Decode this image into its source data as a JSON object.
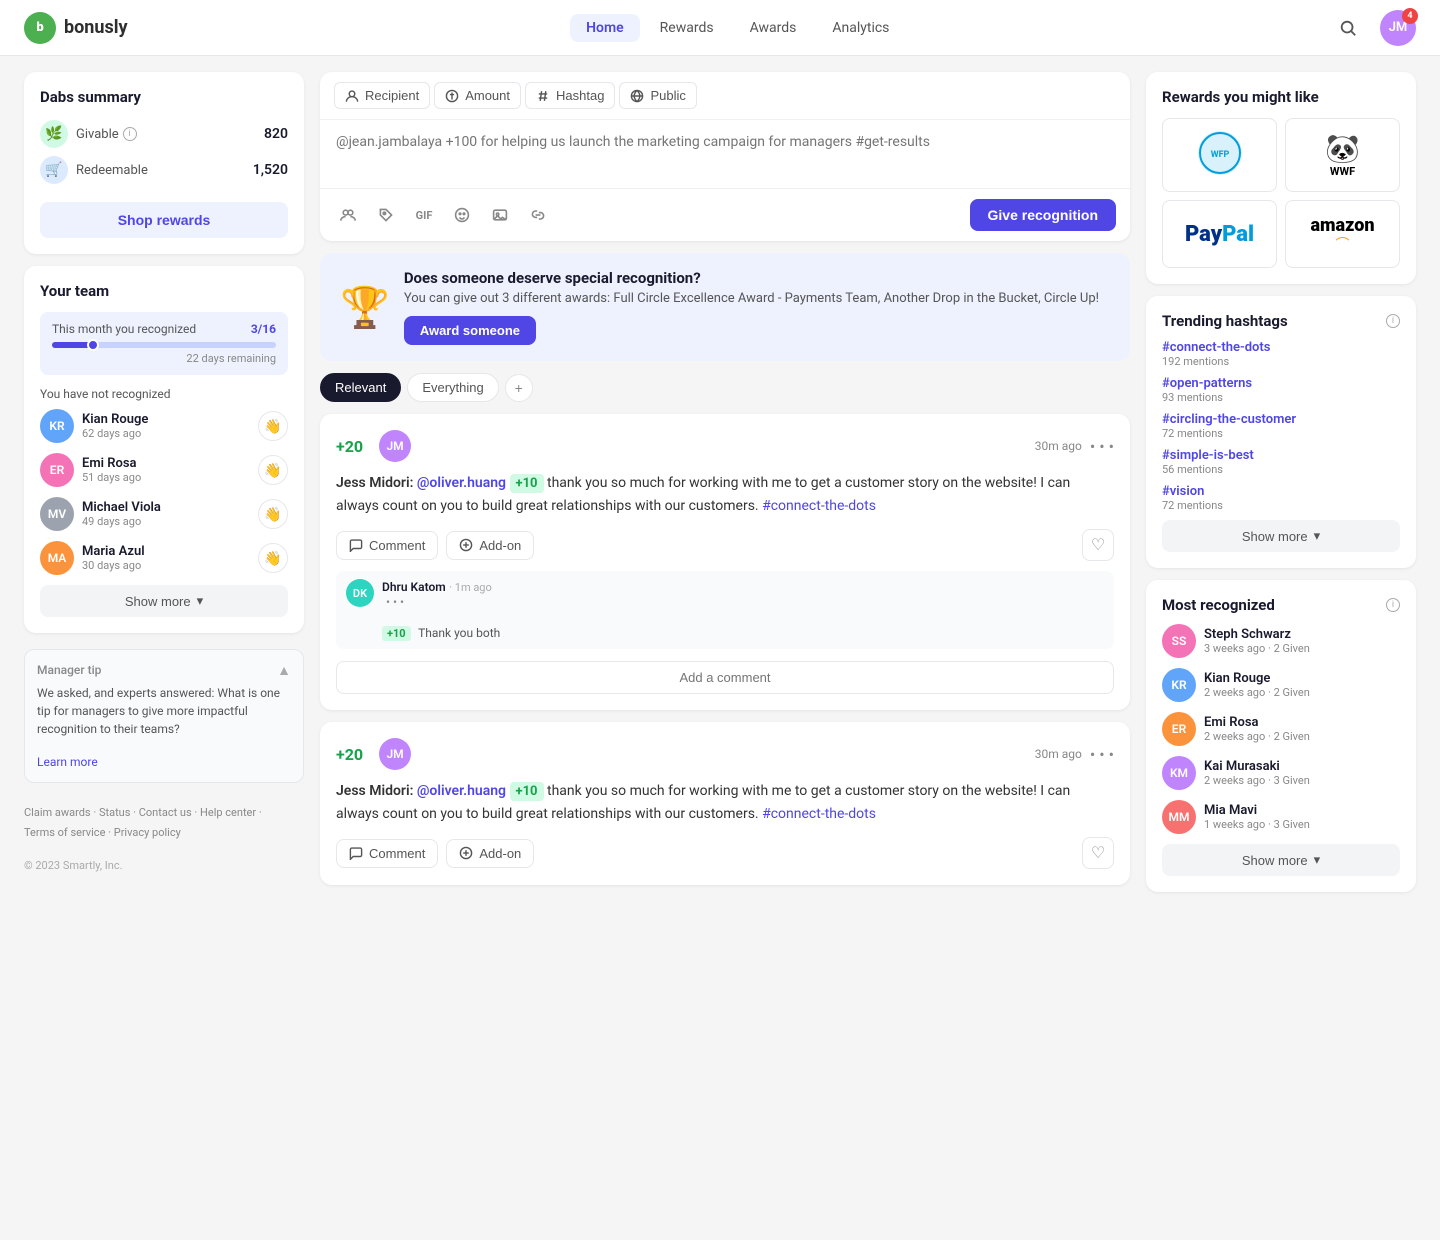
{
  "nav": {
    "logo_text": "bonusly",
    "links": [
      "Home",
      "Rewards",
      "Awards",
      "Analytics"
    ],
    "active_link": "Home",
    "avatar_badge": "4"
  },
  "dabs_summary": {
    "title": "Dabs summary",
    "givable_label": "Givable",
    "givable_value": "820",
    "redeemable_label": "Redeemable",
    "redeemable_value": "1,520",
    "shop_btn": "Shop rewards"
  },
  "your_team": {
    "title": "Your team",
    "month_label": "This month you recognized",
    "month_count": "3/16",
    "days_remaining": "22 days remaining",
    "not_recognized": "You have not recognized",
    "progress_pct": 19,
    "members": [
      {
        "name": "Kian Rouge",
        "days": "62 days ago",
        "color": "av-blue"
      },
      {
        "name": "Emi Rosa",
        "days": "51 days ago",
        "color": "av-pink"
      },
      {
        "name": "Michael Viola",
        "days": "49 days ago",
        "color": "av-gray"
      },
      {
        "name": "Maria Azul",
        "days": "30 days ago",
        "color": "av-orange"
      }
    ],
    "show_more": "Show more"
  },
  "manager_tip": {
    "label": "Manager tip",
    "text": "We asked, and experts answered: What is one tip for managers to give more impactful recognition to their teams?",
    "learn_more": "Learn more"
  },
  "footer": {
    "links": [
      "Claim awards",
      "Status",
      "Contact us",
      "Help center",
      "Terms of service",
      "Privacy policy"
    ],
    "copyright": "© 2023 Smartly, Inc."
  },
  "composer": {
    "recipient_label": "Recipient",
    "amount_label": "Amount",
    "hashtag_label": "Hashtag",
    "visibility_label": "Public",
    "placeholder": "@jean.jambalaya +100 for helping us launch the marketing campaign for managers #get-results",
    "give_btn": "Give recognition",
    "tools": [
      "GIF"
    ]
  },
  "award_banner": {
    "title": "Does someone deserve special recognition?",
    "desc": "You can give out 3 different awards: Full Circle Excellence Award - Payments Team, Another Drop in the Bucket, Circle Up!",
    "btn": "Award someone"
  },
  "feed": {
    "tabs": [
      "Relevant",
      "Everything"
    ],
    "active_tab": "Relevant",
    "posts": [
      {
        "points": "+20",
        "sender": "Jess Midori:",
        "recipient": "@oliver.huang",
        "bonus": "+10",
        "text": " thank you so much for working with me to get a customer story on the website! I can always count on you to build great relationships with our customers. ",
        "hashtag": "#connect-the-dots",
        "time": "30m ago",
        "comments": [
          {
            "name": "Dhru Katom",
            "time": "1m ago",
            "bonus": "+10",
            "text": "Thank you both"
          }
        ],
        "add_comment_placeholder": "Add a comment"
      },
      {
        "points": "+20",
        "sender": "Jess Midori:",
        "recipient": "@oliver.huang",
        "bonus": "+10",
        "text": " thank you so much for working with me to get a customer story on the website! I can always count on you to build great relationships with our customers. ",
        "hashtag": "#connect-the-dots",
        "time": "30m ago",
        "comments": [],
        "add_comment_placeholder": "Add a comment"
      }
    ]
  },
  "rewards_sidebar": {
    "title": "Rewards you might like",
    "items": [
      {
        "name": "WFP",
        "type": "wfp"
      },
      {
        "name": "WWF",
        "type": "wwf"
      },
      {
        "name": "PayPal",
        "type": "paypal"
      },
      {
        "name": "Amazon",
        "type": "amazon"
      }
    ]
  },
  "trending": {
    "title": "Trending hashtags",
    "tags": [
      {
        "tag": "#connect-the-dots",
        "mentions": "192 mentions"
      },
      {
        "tag": "#open-patterns",
        "mentions": "93 mentions"
      },
      {
        "tag": "#circling-the-customer",
        "mentions": "72 mentions"
      },
      {
        "tag": "#simple-is-best",
        "mentions": "56 mentions"
      },
      {
        "tag": "#vision",
        "mentions": "72 mentions"
      }
    ],
    "show_more": "Show more"
  },
  "most_recognized": {
    "title": "Most recognized",
    "people": [
      {
        "name": "Steph Schwarz",
        "meta": "3 weeks ago · 2 Given",
        "color": "av-pink"
      },
      {
        "name": "Kian Rouge",
        "meta": "2 weeks ago · 2 Given",
        "color": "av-blue"
      },
      {
        "name": "Emi Rosa",
        "meta": "2 weeks ago · 2 Given",
        "color": "av-orange"
      },
      {
        "name": "Kai Murasaki",
        "meta": "2 weeks ago · 3 Given",
        "color": "av-purple"
      },
      {
        "name": "Mia Mavi",
        "meta": "1 weeks ago · 3 Given",
        "color": "av-red"
      }
    ],
    "show_more": "Show more"
  }
}
